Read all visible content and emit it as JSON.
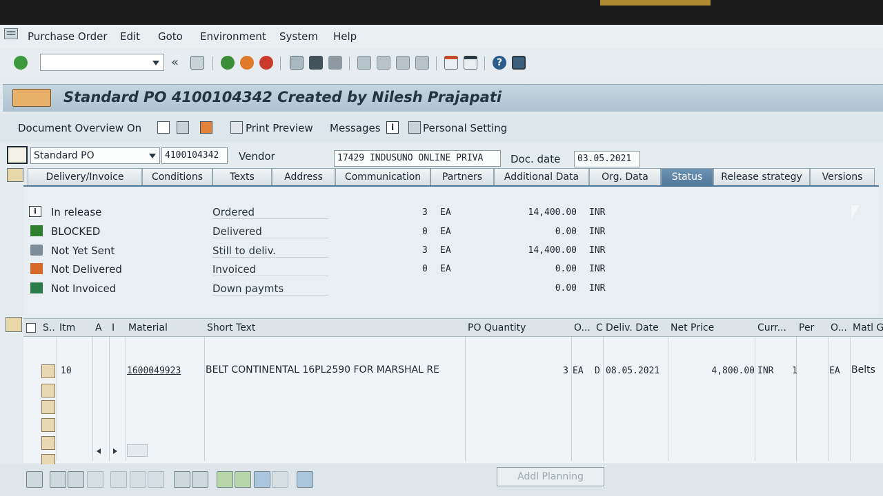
{
  "menu": {
    "items": [
      "Purchase Order",
      "Edit",
      "Goto",
      "Environment",
      "System",
      "Help"
    ]
  },
  "titlebar": {
    "title": "Standard PO 4100104342 Created by Nilesh Prajapati"
  },
  "app_toolbar": {
    "document_overview": "Document Overview On",
    "print_preview": "Print Preview",
    "messages": "Messages",
    "personal_setting": "Personal Setting"
  },
  "header": {
    "doc_type": "Standard PO",
    "po_number": "4100104342",
    "vendor_label": "Vendor",
    "vendor_value": "17429 INDUSUNO ONLINE PRIVA",
    "doc_date_label": "Doc. date",
    "doc_date_value": "03.05.2021"
  },
  "tabs": [
    {
      "label": "Delivery/Invoice",
      "active": false
    },
    {
      "label": "Conditions",
      "active": false
    },
    {
      "label": "Texts",
      "active": false
    },
    {
      "label": "Address",
      "active": false
    },
    {
      "label": "Communication",
      "active": false
    },
    {
      "label": "Partners",
      "active": false
    },
    {
      "label": "Additional Data",
      "active": false
    },
    {
      "label": "Org. Data",
      "active": false
    },
    {
      "label": "Status",
      "active": true
    },
    {
      "label": "Release strategy",
      "active": false
    },
    {
      "label": "Versions",
      "active": false
    }
  ],
  "status": {
    "indicators": [
      {
        "text": "In release",
        "icon": "info-icon"
      },
      {
        "text": "BLOCKED",
        "icon": "flag-icon"
      },
      {
        "text": "Not Yet Sent",
        "icon": "printer-icon"
      },
      {
        "text": "Not Delivered",
        "icon": "truck-icon"
      },
      {
        "text": "Not Invoiced",
        "icon": "invoice-icon"
      }
    ],
    "rows": [
      {
        "label": "Ordered",
        "qty": "3",
        "unit": "EA",
        "amount": "14,400.00",
        "currency": "INR"
      },
      {
        "label": "Delivered",
        "qty": "0",
        "unit": "EA",
        "amount": "0.00",
        "currency": "INR"
      },
      {
        "label": "Still to deliv.",
        "qty": "3",
        "unit": "EA",
        "amount": "14,400.00",
        "currency": "INR"
      },
      {
        "label": "Invoiced",
        "qty": "0",
        "unit": "EA",
        "amount": "0.00",
        "currency": "INR"
      },
      {
        "label": "Down paymts",
        "qty": "",
        "unit": "",
        "amount": "0.00",
        "currency": "INR"
      }
    ]
  },
  "items_table": {
    "columns": [
      "S..",
      "Itm",
      "A",
      "I",
      "Material",
      "Short Text",
      "PO Quantity",
      "O...",
      "C",
      "Deliv. Date",
      "Net Price",
      "Curr...",
      "Per",
      "O...",
      "Matl Gr"
    ],
    "rows": [
      {
        "item": "10",
        "material": "1600049923",
        "short_text": "BELT CONTINENTAL 16PL2590 FOR MARSHAL RE",
        "qty": "3",
        "order_unit": "EA",
        "cat": "D",
        "deliv_date": "08.05.2021",
        "net_price": "4,800.00",
        "currency": "INR",
        "per": "1",
        "unit": "EA",
        "matl_group": "Belts"
      }
    ]
  },
  "bottom": {
    "addl_planning": "Addl Planning"
  },
  "colors": {
    "title_gradient": "#aec2cf",
    "active_tab": "#4f7797",
    "ok_green": "#3c9a3c",
    "cancel_red": "#c83a2a"
  }
}
